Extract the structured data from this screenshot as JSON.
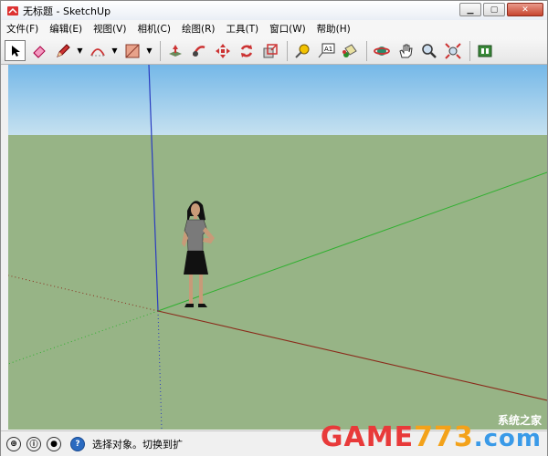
{
  "window": {
    "title": "无标题 - SketchUp"
  },
  "menubar": {
    "items": [
      {
        "label": "文件(F)"
      },
      {
        "label": "编辑(E)"
      },
      {
        "label": "视图(V)"
      },
      {
        "label": "相机(C)"
      },
      {
        "label": "绘图(R)"
      },
      {
        "label": "工具(T)"
      },
      {
        "label": "窗口(W)"
      },
      {
        "label": "帮助(H)"
      }
    ]
  },
  "toolbar": {
    "tools": [
      "select-icon",
      "eraser-icon",
      "pencil-icon",
      "arc-icon",
      "rectangle-icon",
      "push-pull-icon",
      "follow-me-icon",
      "move-icon",
      "rotate-icon",
      "scale-icon",
      "tape-measure-icon",
      "text-icon",
      "paint-bucket-icon",
      "orbit-icon",
      "pan-icon",
      "zoom-icon",
      "zoom-extents-icon",
      "warehouse-icon"
    ],
    "text_tool_label": "A1"
  },
  "statusbar": {
    "text": "选择对象。切换到扩",
    "info_icon": "?"
  },
  "watermark": {
    "main": "GAME",
    "num": "773",
    "suffix": ".com",
    "sub": "系统之家"
  },
  "colors": {
    "sky_top": "#75b8e8",
    "ground": "#97b486",
    "axis_blue": "#2a3cc0",
    "axis_green": "#2fb02f",
    "axis_red": "#8a2a1a"
  }
}
